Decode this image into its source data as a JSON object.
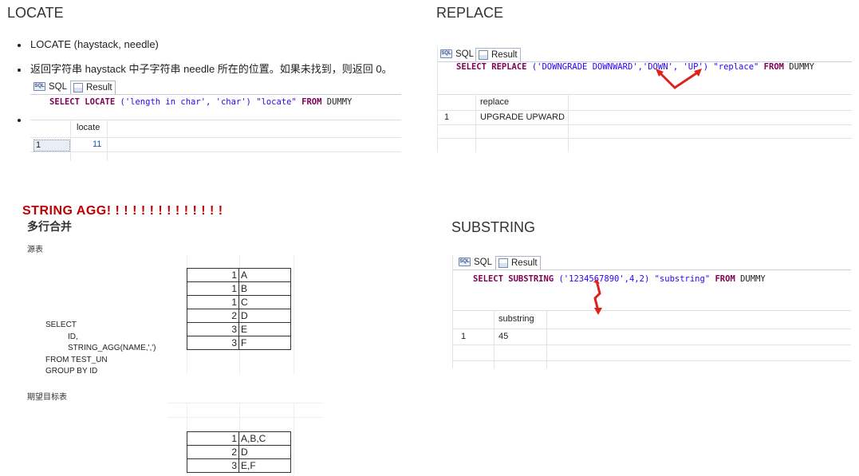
{
  "locate": {
    "heading": "LOCATE",
    "bullet1": "LOCATE (haystack, needle)",
    "bullet2": "返回字符串 haystack 中子字符串 needle 所在的位置。如果未找到，则返回 0。",
    "tab_sql": "SQL",
    "tab_result": "Result",
    "sql_kw1": "SELECT LOCATE",
    "sql_args": "('length in char', 'char')",
    "sql_alias": "\"locate\"",
    "sql_kw2": "FROM",
    "sql_table": "DUMMY",
    "col_header": "locate",
    "row_num": "1",
    "row_value": "11"
  },
  "replace": {
    "heading": "REPLACE",
    "tab_sql": "SQL",
    "tab_result": "Result",
    "sql_kw1": "SELECT REPLACE",
    "sql_args": "('DOWNGRADE DOWNWARD','DOWN', 'UP')",
    "sql_alias": "\"replace\"",
    "sql_kw2": "FROM",
    "sql_table": "DUMMY",
    "col_header": "replace",
    "row_num": "1",
    "row_value": "UPGRADE UPWARD"
  },
  "string_agg": {
    "heading": "STRING AGG! ! ! ! ! ! ! ! ! ! ! ! ! !",
    "subheading": "多行合并",
    "source_label": "源表",
    "source_rows": [
      {
        "id": "1",
        "name": "A"
      },
      {
        "id": "1",
        "name": "B"
      },
      {
        "id": "1",
        "name": "C"
      },
      {
        "id": "2",
        "name": "D"
      },
      {
        "id": "3",
        "name": "E"
      },
      {
        "id": "3",
        "name": "F"
      }
    ],
    "sql_line1": "SELECT",
    "sql_line2": "ID,",
    "sql_line3": "STRING_AGG(NAME,',')",
    "sql_line4": "FROM TEST_UN",
    "sql_line5": "GROUP BY ID",
    "target_label": "期望目标表",
    "target_rows": [
      {
        "id": "1",
        "name": "A,B,C"
      },
      {
        "id": "2",
        "name": "D"
      },
      {
        "id": "3",
        "name": "E,F"
      }
    ]
  },
  "substring": {
    "heading": "SUBSTRING",
    "tab_sql": "SQL",
    "tab_result": "Result",
    "sql_kw1": "SELECT SUBSTRING",
    "sql_args": "('1234567890',4,2)",
    "sql_alias": "\"substring\"",
    "sql_kw2": "FROM",
    "sql_table": "DUMMY",
    "col_header": "substring",
    "row_num": "1",
    "row_value": "45"
  },
  "colors": {
    "keyword": "#7f0055",
    "string": "#2a00ff",
    "heading_red": "#c00000",
    "arrow_red": "#e0201b"
  }
}
